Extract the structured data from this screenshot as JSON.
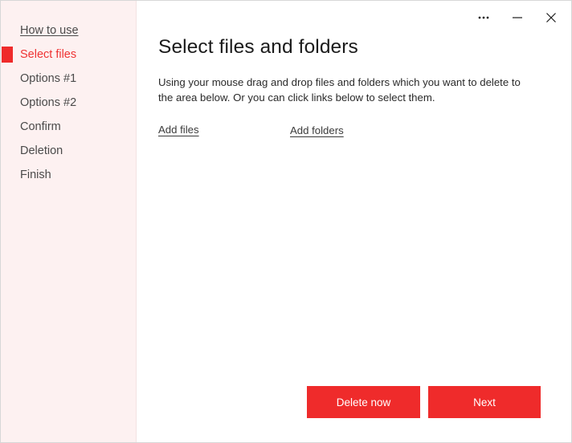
{
  "window": {
    "controls": [
      {
        "name": "more-options-button",
        "icon": "ellipsis-icon",
        "label": "•••"
      },
      {
        "name": "minimize-button",
        "icon": "minimize-icon",
        "label": "—"
      },
      {
        "name": "close-button",
        "icon": "close-icon",
        "label": "✕"
      }
    ]
  },
  "colors": {
    "accent": "#ef2b2b",
    "accent_text": "#ef3434",
    "sidebar_bg": "#fdf1f1",
    "window_border": "#d7d7d7",
    "body_text": "#2a2a2a",
    "title_text": "#1b1b1b"
  },
  "sidebar": {
    "items": [
      {
        "label": "How to use",
        "state": "link"
      },
      {
        "label": "Select files",
        "state": "active"
      },
      {
        "label": "Options #1",
        "state": "normal"
      },
      {
        "label": "Options #2",
        "state": "normal"
      },
      {
        "label": "Confirm",
        "state": "normal"
      },
      {
        "label": "Deletion",
        "state": "normal"
      },
      {
        "label": "Finish",
        "state": "normal"
      }
    ]
  },
  "main": {
    "title": "Select files and folders",
    "description": "Using your mouse drag and drop files and folders which you want to delete to the area below. Or you can click links below to select them.",
    "links": [
      {
        "label": "Add files",
        "name": "add-files-link"
      },
      {
        "label": "Add folders",
        "name": "add-folders-link"
      }
    ],
    "drop_area_items": []
  },
  "footer": {
    "delete_now_label": "Delete now",
    "next_label": "Next"
  }
}
